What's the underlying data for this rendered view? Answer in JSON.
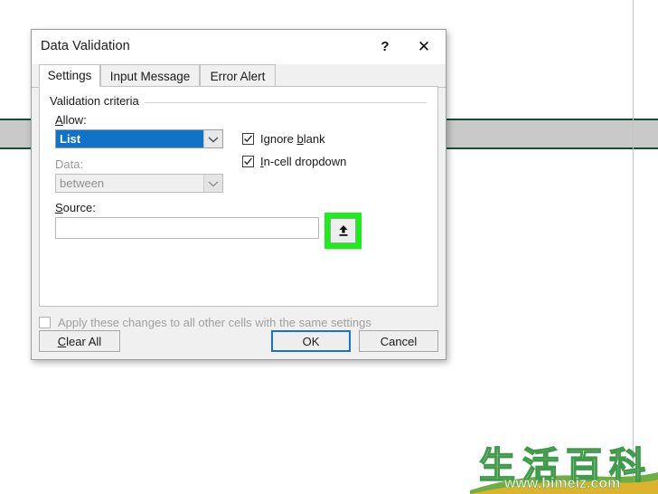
{
  "dialog": {
    "title": "Data Validation",
    "help_button": "?",
    "close_button": "✕",
    "tabs": [
      {
        "label": "Settings",
        "active": true
      },
      {
        "label": "Input Message",
        "active": false
      },
      {
        "label": "Error Alert",
        "active": false
      }
    ],
    "group_label": "Validation criteria",
    "allow": {
      "label": "Allow:",
      "value": "List",
      "selected": true,
      "enabled": true
    },
    "data": {
      "label": "Data:",
      "value": "between",
      "enabled": false
    },
    "source": {
      "label": "Source:",
      "value": "",
      "placeholder": "",
      "range_button_icon": "range-select-up-arrow-icon",
      "highlight_color": "#18f018"
    },
    "checkboxes": [
      {
        "label": "Ignore blank",
        "checked": true,
        "enabled": true
      },
      {
        "label": "In-cell dropdown",
        "checked": true,
        "enabled": true
      }
    ],
    "apply_all": {
      "label": "Apply these changes to all other cells with the same settings",
      "checked": false,
      "enabled": false
    },
    "buttons": {
      "clear_all": "Clear All",
      "ok": "OK",
      "cancel": "Cancel",
      "default_focus": "OK",
      "focus_color": "#1374c8"
    }
  },
  "background": {
    "band_fill": "#c9c9c9",
    "band_line": "#0d5232"
  },
  "watermark": {
    "characters": "生活百科",
    "url": "www.bimeiz.com",
    "color": "#3f9a4a"
  }
}
